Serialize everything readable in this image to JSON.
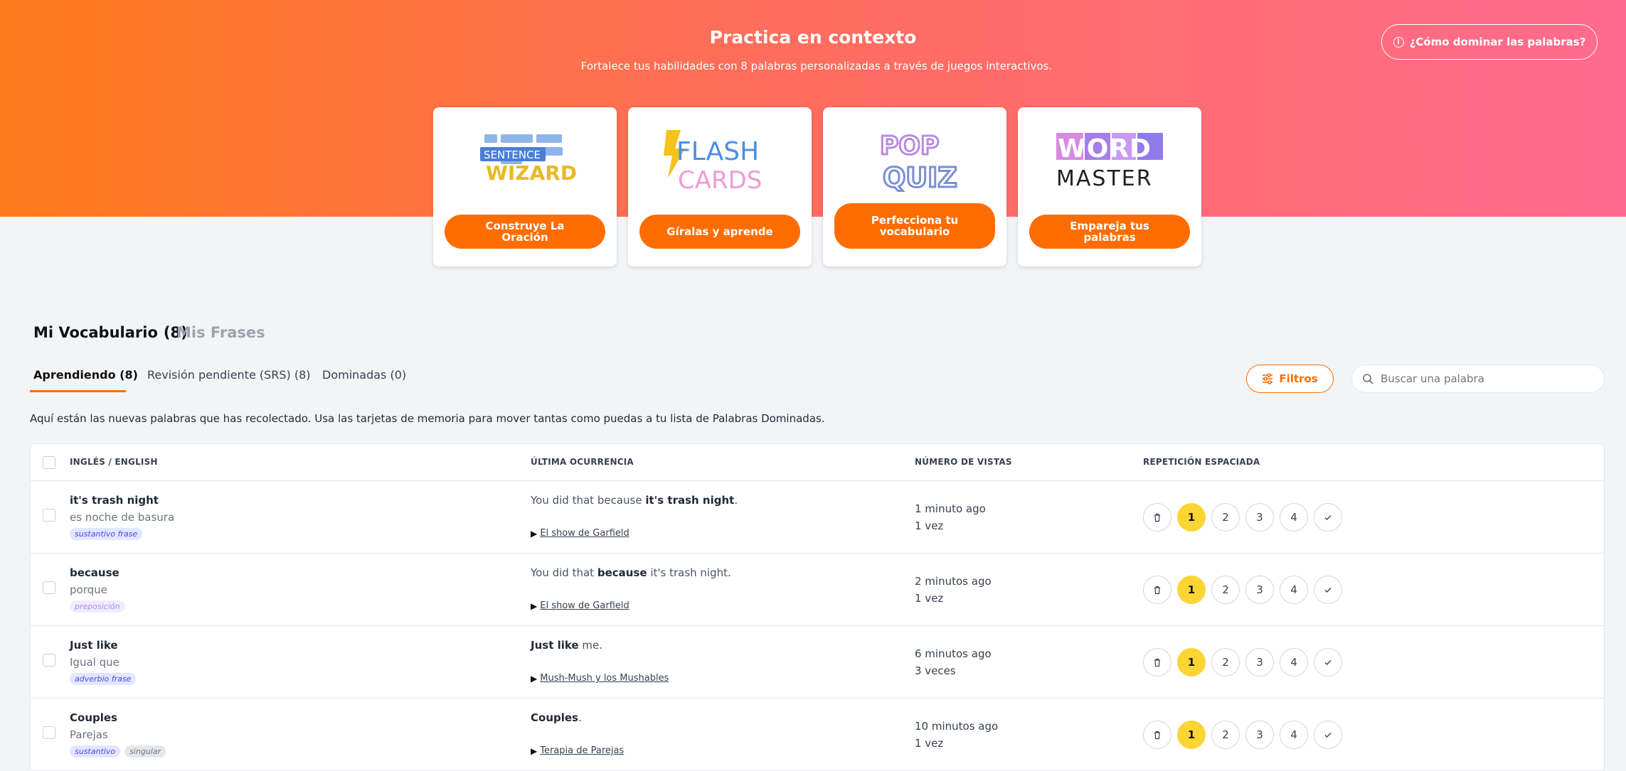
{
  "hero": {
    "title": "Practica en contexto",
    "subtitle": "Fortalece tus habilidades con 8 palabras personalizadas a través de juegos interactivos.",
    "help_button": "¿Cómo dominar las palabras?"
  },
  "games": [
    {
      "logo": "SENTENCE WIZARD",
      "logo_line1": "SENTENCE",
      "logo_line2": "WIZARD",
      "button": "Construye La Oración"
    },
    {
      "logo": "FLASH CARDS",
      "logo_line1": "FLASH",
      "logo_line2": "CARDS",
      "button": "Gíralas y aprende"
    },
    {
      "logo": "POP QUIZ",
      "logo_line1": "POP",
      "logo_line2": "QUIZ",
      "button": "Perfecciona tu vocabulario"
    },
    {
      "logo": "WORD MASTER",
      "logo_line1": "WORD",
      "logo_line2": "MASTER",
      "button": "Empareja tus palabras"
    }
  ],
  "section": {
    "title": "Mi Vocabulario",
    "count": "(8)",
    "other_tab": "Mis Frases"
  },
  "tabs": [
    {
      "label": "Aprendiendo (8)",
      "active": true
    },
    {
      "label": "Revisión pendiente (SRS) (8)",
      "active": false
    },
    {
      "label": "Dominadas (0)",
      "active": false
    }
  ],
  "filters_button": "Filtros",
  "search": {
    "placeholder": "Buscar una palabra"
  },
  "description": "Aquí están las nuevas palabras que has recolectado. Usa las tarjetas de memoria para mover tantas como puedas a tu lista de Palabras Dominadas.",
  "table": {
    "headers": [
      "INGLÉS / ENGLISH",
      "ÚLTIMA OCURRENCIA",
      "NÚMERO DE VISTAS",
      "REPETICIÓN ESPACIADA"
    ],
    "srs_levels": [
      "1",
      "2",
      "3",
      "4"
    ],
    "rows": [
      {
        "en": "it's trash night",
        "es": "es noche de basura",
        "tags": [
          {
            "text": "sustantivo frase",
            "color": "#4f46e5"
          }
        ],
        "ctx_before": "You did that because ",
        "ctx_bold": "it's trash night",
        "ctx_after": ".",
        "source": "El show de Garfield",
        "time": "1 minuto ago",
        "views": "1 vez",
        "srs_level": 1
      },
      {
        "en": "because",
        "es": "porque",
        "tags": [
          {
            "text": "preposición",
            "color": "#a78bfa"
          }
        ],
        "ctx_before": "You did that ",
        "ctx_bold": "because",
        "ctx_after": " it's trash night.",
        "source": "El show de Garfield",
        "time": "2 minutos ago",
        "views": "1 vez",
        "srs_level": 1
      },
      {
        "en": "Just like",
        "es": "Igual que",
        "tags": [
          {
            "text": "adverbio frase",
            "color": "#4f46e5"
          }
        ],
        "ctx_before": "",
        "ctx_bold": "Just like",
        "ctx_after": " me.",
        "source": "Mush-Mush y los Mushables",
        "time": "6 minutos ago",
        "views": "3 veces",
        "srs_level": 1
      },
      {
        "en": "Couples",
        "es": "Parejas",
        "tags": [
          {
            "text": "sustantivo",
            "color": "#4f46e5"
          },
          {
            "text": "singular",
            "color": "#6b7280"
          }
        ],
        "ctx_before": "",
        "ctx_bold": "Couples",
        "ctx_after": ".",
        "source": "Terapia de Parejas",
        "time": "10 minutos ago",
        "views": "1 vez",
        "srs_level": 1
      }
    ]
  },
  "colors": {
    "accent": "#ff6d00",
    "srs_active": "#fcd535"
  }
}
